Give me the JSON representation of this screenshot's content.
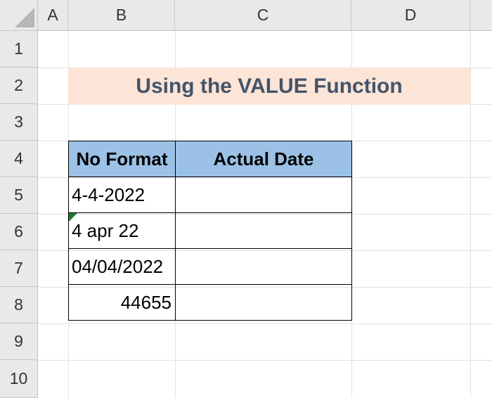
{
  "columns": [
    "A",
    "B",
    "C",
    "D"
  ],
  "rows": [
    "1",
    "2",
    "3",
    "4",
    "5",
    "6",
    "7",
    "8",
    "9",
    "10"
  ],
  "title": "Using the VALUE Function",
  "table": {
    "headers": [
      "No Format",
      "Actual Date"
    ],
    "rows": [
      {
        "no_format": "4-4-2022",
        "actual_date": ""
      },
      {
        "no_format": "4 apr 22",
        "actual_date": ""
      },
      {
        "no_format": "04/04/2022",
        "actual_date": ""
      },
      {
        "no_format": "44655",
        "actual_date": ""
      }
    ]
  },
  "colors": {
    "title_fill": "#fce4d6",
    "title_text": "#44546a",
    "header_fill": "#9bc2e6",
    "error_indicator": "#1e7a34"
  }
}
